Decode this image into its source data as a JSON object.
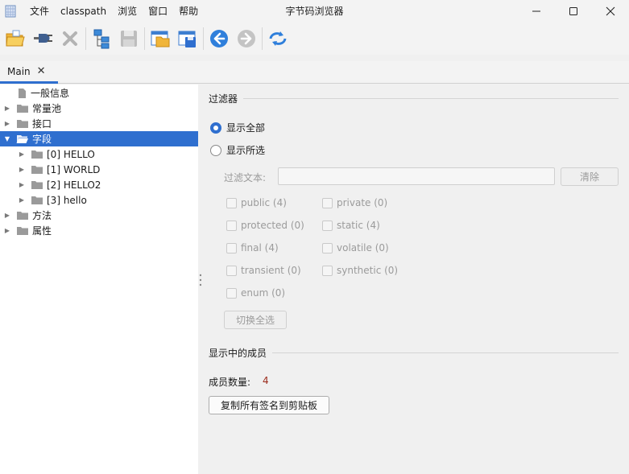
{
  "window": {
    "title": "字节码浏览器"
  },
  "menu": {
    "items": [
      "文件",
      "classpath",
      "浏览",
      "窗口",
      "帮助"
    ]
  },
  "toolbar": {
    "icons": [
      "open-folder-icon",
      "plug-icon",
      "close-x-icon",
      "tree-hierarchy-icon",
      "save-icon",
      "open-window-icon",
      "save-window-icon",
      "back-icon",
      "forward-icon",
      "sync-icon"
    ]
  },
  "tabs": [
    {
      "label": "Main",
      "close": "✕"
    }
  ],
  "tree": {
    "items": [
      {
        "label": "一般信息",
        "level": 0,
        "type": "file"
      },
      {
        "label": "常量池",
        "level": 0,
        "type": "folder"
      },
      {
        "label": "接口",
        "level": 0,
        "type": "folder"
      },
      {
        "label": "字段",
        "level": 0,
        "type": "folder-open",
        "selected": true
      },
      {
        "label": "[0] HELLO",
        "level": 1,
        "type": "folder"
      },
      {
        "label": "[1] WORLD",
        "level": 1,
        "type": "folder"
      },
      {
        "label": "[2] HELLO2",
        "level": 1,
        "type": "folder"
      },
      {
        "label": "[3] hello",
        "level": 1,
        "type": "folder"
      },
      {
        "label": "方法",
        "level": 0,
        "type": "folder"
      },
      {
        "label": "属性",
        "level": 0,
        "type": "folder"
      }
    ]
  },
  "filter": {
    "section_title": "过滤器",
    "show_all_label": "显示全部",
    "show_selected_label": "显示所选",
    "filter_text_label": "过滤文本:",
    "filter_text_value": "",
    "clear_label": "清除",
    "checkboxes": [
      {
        "label": "public (4)"
      },
      {
        "label": "private (0)"
      },
      {
        "label": "protected (0)"
      },
      {
        "label": "static (4)"
      },
      {
        "label": "final (4)"
      },
      {
        "label": "volatile (0)"
      },
      {
        "label": "transient (0)"
      },
      {
        "label": "synthetic (0)"
      },
      {
        "label": "enum (0)"
      }
    ],
    "toggle_all_label": "切换全选"
  },
  "members": {
    "section_title": "显示中的成员",
    "count_label": "成员数量:",
    "count_value": "4",
    "copy_button_label": "复制所有签名到剪贴板"
  },
  "colors": {
    "accent": "#2f6fcf",
    "count_value": "#9b2a1a",
    "disabled_text": "#9b9b9b"
  }
}
